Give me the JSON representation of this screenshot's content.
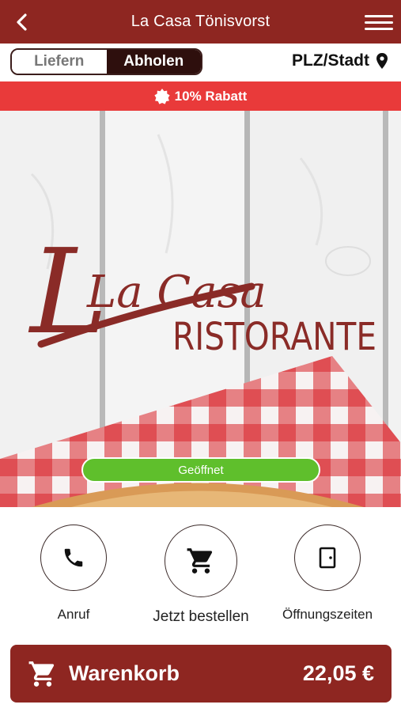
{
  "header": {
    "title": "La Casa Tönisvorst"
  },
  "mode": {
    "deliver_label": "Liefern",
    "pickup_label": "Abholen",
    "selected": "Abholen"
  },
  "location": {
    "label": "PLZ/Stadt"
  },
  "promo": {
    "text": "10% Rabatt"
  },
  "hero": {
    "logo_script": "La Casa",
    "logo_sub": "RISTORANTE",
    "status": "Geöffnet"
  },
  "actions": [
    {
      "label": "Anruf"
    },
    {
      "label": "Jetzt bestellen"
    },
    {
      "label": "Öffnungszeiten"
    }
  ],
  "cart": {
    "label": "Warenkorb",
    "total": "22,05 €"
  },
  "colors": {
    "brand": "#8e2621",
    "promo": "#e93a3a",
    "open": "#5fbf2c",
    "segment_active": "#2e0f0d"
  }
}
